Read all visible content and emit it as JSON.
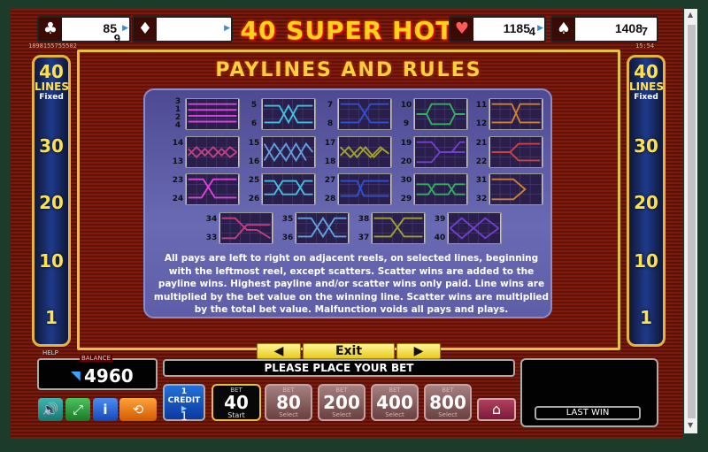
{
  "game": {
    "title": "40 SUPER HOT",
    "session_id": "1898155755502",
    "clock": "15:54"
  },
  "jackpots": [
    {
      "suit": "clubs",
      "symbol": "♣",
      "value": "85",
      "sub": "9"
    },
    {
      "suit": "diamonds",
      "symbol": "♦",
      "value": "",
      "sub": ""
    },
    {
      "suit": "hearts",
      "symbol": "♥",
      "value": "1185",
      "sub": "4"
    },
    {
      "suit": "spades",
      "symbol": "♠",
      "value": "1408",
      "sub": "7"
    }
  ],
  "lines_column": {
    "header": {
      "count": "40",
      "label": "LINES",
      "sub": "Fixed"
    },
    "values": [
      "30",
      "20",
      "10",
      "1"
    ]
  },
  "rules": {
    "title": "PAYLINES AND RULES",
    "text": "All pays are left to right on adjacent reels, on selected lines, beginning with the leftmost reel, except scatters. Scatter wins are added to the payline wins.  Highest payline and/or scatter wins only paid. Line wins are multiplied by the bet value on the winning line. Scatter wins are multiplied by the total bet value. Malfunction voids all pays and plays.",
    "paylines": [
      {
        "left": [
          "3",
          "1",
          "2",
          "4"
        ],
        "right": []
      },
      {
        "left": [
          "5",
          "6"
        ],
        "right": []
      },
      {
        "left": [
          "7",
          "8"
        ],
        "right": []
      },
      {
        "left": [
          "10",
          "9"
        ],
        "right": []
      },
      {
        "left": [
          "11",
          "12"
        ],
        "right": []
      },
      {
        "left": [
          "14",
          "13"
        ],
        "right": []
      },
      {
        "left": [
          "15",
          "16"
        ],
        "right": []
      },
      {
        "left": [
          "17",
          "18"
        ],
        "right": []
      },
      {
        "left": [
          "19",
          "20"
        ],
        "right": []
      },
      {
        "left": [
          "21",
          "22"
        ],
        "right": []
      },
      {
        "left": [
          "23",
          "24"
        ],
        "right": []
      },
      {
        "left": [
          "25",
          "26"
        ],
        "right": []
      },
      {
        "left": [
          "27",
          "28"
        ],
        "right": []
      },
      {
        "left": [
          "30",
          "29"
        ],
        "right": []
      },
      {
        "left": [
          "31",
          "32"
        ],
        "right": []
      },
      {
        "left": [
          "34",
          "33"
        ],
        "right": []
      },
      {
        "left": [
          "35",
          "36"
        ],
        "right": []
      },
      {
        "left": [
          "38",
          "37"
        ],
        "right": []
      },
      {
        "left": [
          "39",
          "40"
        ],
        "right": []
      }
    ]
  },
  "nav": {
    "prev": "◀",
    "exit": "Exit",
    "next": "▶"
  },
  "balance": {
    "label": "BALANCE",
    "value": "4960",
    "help": "HELP"
  },
  "message": "PLEASE PLACE YOUR BET",
  "last_win": {
    "label": "LAST WIN"
  },
  "credit": {
    "label": "1 CREDIT",
    "value": "1"
  },
  "bet": {
    "label": "BET",
    "value": "40",
    "start": "Start"
  },
  "bet_options": [
    {
      "label": "BET",
      "value": "80",
      "start": "Select"
    },
    {
      "label": "BET",
      "value": "200",
      "start": "Select"
    },
    {
      "label": "BET",
      "value": "400",
      "start": "Select"
    },
    {
      "label": "BET",
      "value": "800",
      "start": "Select"
    }
  ]
}
